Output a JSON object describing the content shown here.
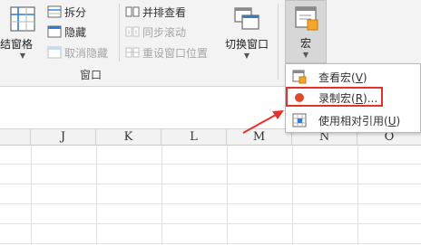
{
  "ribbon": {
    "freeze_panes": {
      "label": "冻结窗格",
      "visible_label": "冻结窗格"
    },
    "split": {
      "label": "拆分"
    },
    "hide": {
      "label": "隐藏"
    },
    "unhide": {
      "label": "取消隐藏"
    },
    "side_by_side": {
      "label": "并排查看"
    },
    "sync_scroll": {
      "label": "同步滚动"
    },
    "reset_position": {
      "label": "重设窗口位置"
    },
    "switch_windows": {
      "label": "切换窗口"
    },
    "macros": {
      "label": "宏"
    },
    "group_window_label": "窗口"
  },
  "columns": [
    "J",
    "K",
    "L",
    "M",
    "N",
    "O"
  ],
  "macro_menu": {
    "items": [
      {
        "label": "查看宏(",
        "key": "V",
        "suffix": ")"
      },
      {
        "label": "录制宏(",
        "key": "R",
        "suffix": ")..."
      },
      {
        "label": "使用相对引用(",
        "key": "U",
        "suffix": ")"
      }
    ]
  },
  "colors": {
    "highlight": "#e4312b",
    "record_dot": "#e04a2a",
    "ribbon_bg": "#f3f3f3"
  }
}
